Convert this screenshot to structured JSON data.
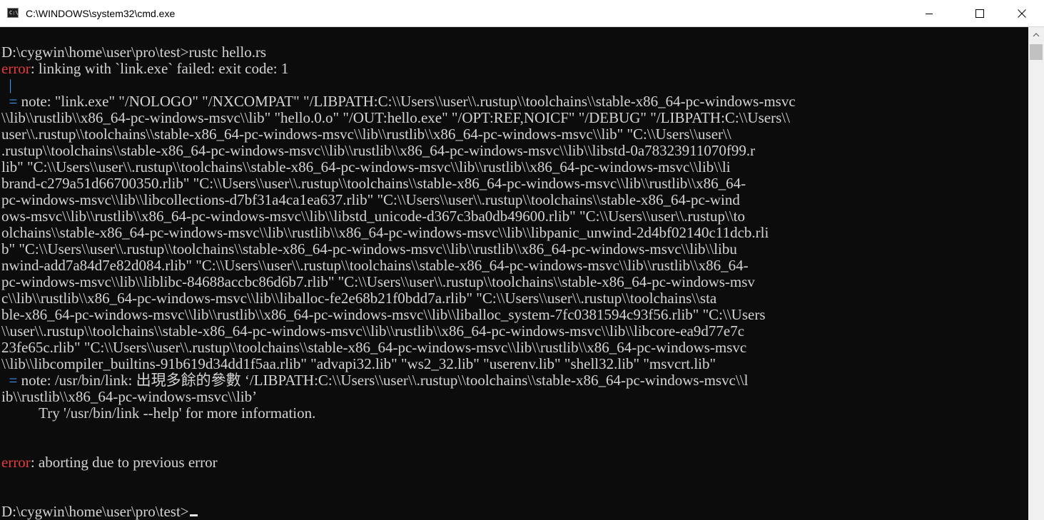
{
  "window": {
    "title": "C:\\WINDOWS\\system32\\cmd.exe",
    "app_icon_text": "C:\\"
  },
  "terminal": {
    "lines": [
      {
        "parts": [
          {
            "t": "D:\\cygwin\\home\\user\\pro\\test>rustc hello.rs",
            "c": "normal"
          }
        ]
      },
      {
        "parts": [
          {
            "t": "error",
            "c": "err"
          },
          {
            "t": ": linking with `link.exe` failed: exit code: 1",
            "c": "normal"
          }
        ]
      },
      {
        "parts": [
          {
            "t": "  |",
            "c": "blue"
          }
        ]
      },
      {
        "parts": [
          {
            "t": "  = ",
            "c": "blue"
          },
          {
            "t": "note: \"link.exe\" \"/NOLOGO\" \"/NXCOMPAT\" \"/LIBPATH:C:\\\\Users\\\\user\\\\.rustup\\\\toolchains\\\\stable-x86_64-pc-windows-msvc",
            "c": "normal"
          }
        ]
      },
      {
        "parts": [
          {
            "t": "\\\\lib\\\\rustlib\\\\x86_64-pc-windows-msvc\\\\lib\" \"hello.0.o\" \"/OUT:hello.exe\" \"/OPT:REF,NOICF\" \"/DEBUG\" \"/LIBPATH:C:\\\\Users\\\\",
            "c": "normal"
          }
        ]
      },
      {
        "parts": [
          {
            "t": "user\\\\.rustup\\\\toolchains\\\\stable-x86_64-pc-windows-msvc\\\\lib\\\\rustlib\\\\x86_64-pc-windows-msvc\\\\lib\" \"C:\\\\Users\\\\user\\\\",
            "c": "normal"
          }
        ]
      },
      {
        "parts": [
          {
            "t": ".rustup\\\\toolchains\\\\stable-x86_64-pc-windows-msvc\\\\lib\\\\rustlib\\\\x86_64-pc-windows-msvc\\\\lib\\\\libstd-0a78323911070f99.r",
            "c": "normal"
          }
        ]
      },
      {
        "parts": [
          {
            "t": "lib\" \"C:\\\\Users\\\\user\\\\.rustup\\\\toolchains\\\\stable-x86_64-pc-windows-msvc\\\\lib\\\\rustlib\\\\x86_64-pc-windows-msvc\\\\lib\\\\li",
            "c": "normal"
          }
        ]
      },
      {
        "parts": [
          {
            "t": "brand-c279a51d66700350.rlib\" \"C:\\\\Users\\\\user\\\\.rustup\\\\toolchains\\\\stable-x86_64-pc-windows-msvc\\\\lib\\\\rustlib\\\\x86_64-",
            "c": "normal"
          }
        ]
      },
      {
        "parts": [
          {
            "t": "pc-windows-msvc\\\\lib\\\\libcollections-d7bf31a4ca1ea637.rlib\" \"C:\\\\Users\\\\user\\\\.rustup\\\\toolchains\\\\stable-x86_64-pc-wind",
            "c": "normal"
          }
        ]
      },
      {
        "parts": [
          {
            "t": "ows-msvc\\\\lib\\\\rustlib\\\\x86_64-pc-windows-msvc\\\\lib\\\\libstd_unicode-d367c3ba0db49600.rlib\" \"C:\\\\Users\\\\user\\\\.rustup\\\\to",
            "c": "normal"
          }
        ]
      },
      {
        "parts": [
          {
            "t": "olchains\\\\stable-x86_64-pc-windows-msvc\\\\lib\\\\rustlib\\\\x86_64-pc-windows-msvc\\\\lib\\\\libpanic_unwind-2d4bf02140c11dcb.rli",
            "c": "normal"
          }
        ]
      },
      {
        "parts": [
          {
            "t": "b\" \"C:\\\\Users\\\\user\\\\.rustup\\\\toolchains\\\\stable-x86_64-pc-windows-msvc\\\\lib\\\\rustlib\\\\x86_64-pc-windows-msvc\\\\lib\\\\libu",
            "c": "normal"
          }
        ]
      },
      {
        "parts": [
          {
            "t": "nwind-add7a84d7e82d084.rlib\" \"C:\\\\Users\\\\user\\\\.rustup\\\\toolchains\\\\stable-x86_64-pc-windows-msvc\\\\lib\\\\rustlib\\\\x86_64-",
            "c": "normal"
          }
        ]
      },
      {
        "parts": [
          {
            "t": "pc-windows-msvc\\\\lib\\\\liblibc-84688accbc86d6b7.rlib\" \"C:\\\\Users\\\\user\\\\.rustup\\\\toolchains\\\\stable-x86_64-pc-windows-msv",
            "c": "normal"
          }
        ]
      },
      {
        "parts": [
          {
            "t": "c\\\\lib\\\\rustlib\\\\x86_64-pc-windows-msvc\\\\lib\\\\liballoc-fe2e68b21f0bdd7a.rlib\" \"C:\\\\Users\\\\user\\\\.rustup\\\\toolchains\\\\sta",
            "c": "normal"
          }
        ]
      },
      {
        "parts": [
          {
            "t": "ble-x86_64-pc-windows-msvc\\\\lib\\\\rustlib\\\\x86_64-pc-windows-msvc\\\\lib\\\\liballoc_system-7fc0381594c93f56.rlib\" \"C:\\\\Users",
            "c": "normal"
          }
        ]
      },
      {
        "parts": [
          {
            "t": "\\\\user\\\\.rustup\\\\toolchains\\\\stable-x86_64-pc-windows-msvc\\\\lib\\\\rustlib\\\\x86_64-pc-windows-msvc\\\\lib\\\\libcore-ea9d77e7c",
            "c": "normal"
          }
        ]
      },
      {
        "parts": [
          {
            "t": "23fe65c.rlib\" \"C:\\\\Users\\\\user\\\\.rustup\\\\toolchains\\\\stable-x86_64-pc-windows-msvc\\\\lib\\\\rustlib\\\\x86_64-pc-windows-msvc",
            "c": "normal"
          }
        ]
      },
      {
        "parts": [
          {
            "t": "\\\\lib\\\\libcompiler_builtins-91b619d34dd1f5aa.rlib\" \"advapi32.lib\" \"ws2_32.lib\" \"userenv.lib\" \"shell32.lib\" \"msvcrt.lib\"",
            "c": "normal"
          }
        ]
      },
      {
        "parts": [
          {
            "t": "  = ",
            "c": "blue"
          },
          {
            "t": "note: /usr/bin/link: 出現多餘的參數 ‘/LIBPATH:C:\\\\Users\\\\user\\\\.rustup\\\\toolchains\\\\stable-x86_64-pc-windows-msvc\\\\l",
            "c": "normal"
          }
        ]
      },
      {
        "parts": [
          {
            "t": "ib\\\\rustlib\\\\x86_64-pc-windows-msvc\\\\lib’",
            "c": "normal"
          }
        ]
      },
      {
        "parts": [
          {
            "t": "          Try '/usr/bin/link --help' for more information.",
            "c": "normal"
          }
        ]
      },
      {
        "parts": [
          {
            "t": "",
            "c": "normal"
          }
        ]
      },
      {
        "parts": [
          {
            "t": "",
            "c": "normal"
          }
        ]
      },
      {
        "parts": [
          {
            "t": "error",
            "c": "err"
          },
          {
            "t": ": aborting due to previous error",
            "c": "normal"
          }
        ]
      },
      {
        "parts": [
          {
            "t": "",
            "c": "normal"
          }
        ]
      },
      {
        "parts": [
          {
            "t": "",
            "c": "normal"
          }
        ]
      },
      {
        "parts": [
          {
            "t": "D:\\cygwin\\home\\user\\pro\\test>",
            "c": "normal"
          }
        ],
        "cursor": true
      }
    ]
  },
  "colors": {
    "background": "#0c0c0c",
    "text": "#d4d4d4",
    "error": "#e63b3b",
    "note_marker": "#3aa0ff"
  },
  "icons": {
    "app": "cmd-icon",
    "minimize": "minimize-icon",
    "maximize": "maximize-icon",
    "close": "close-icon",
    "scroll_up": "chevron-up-icon"
  }
}
